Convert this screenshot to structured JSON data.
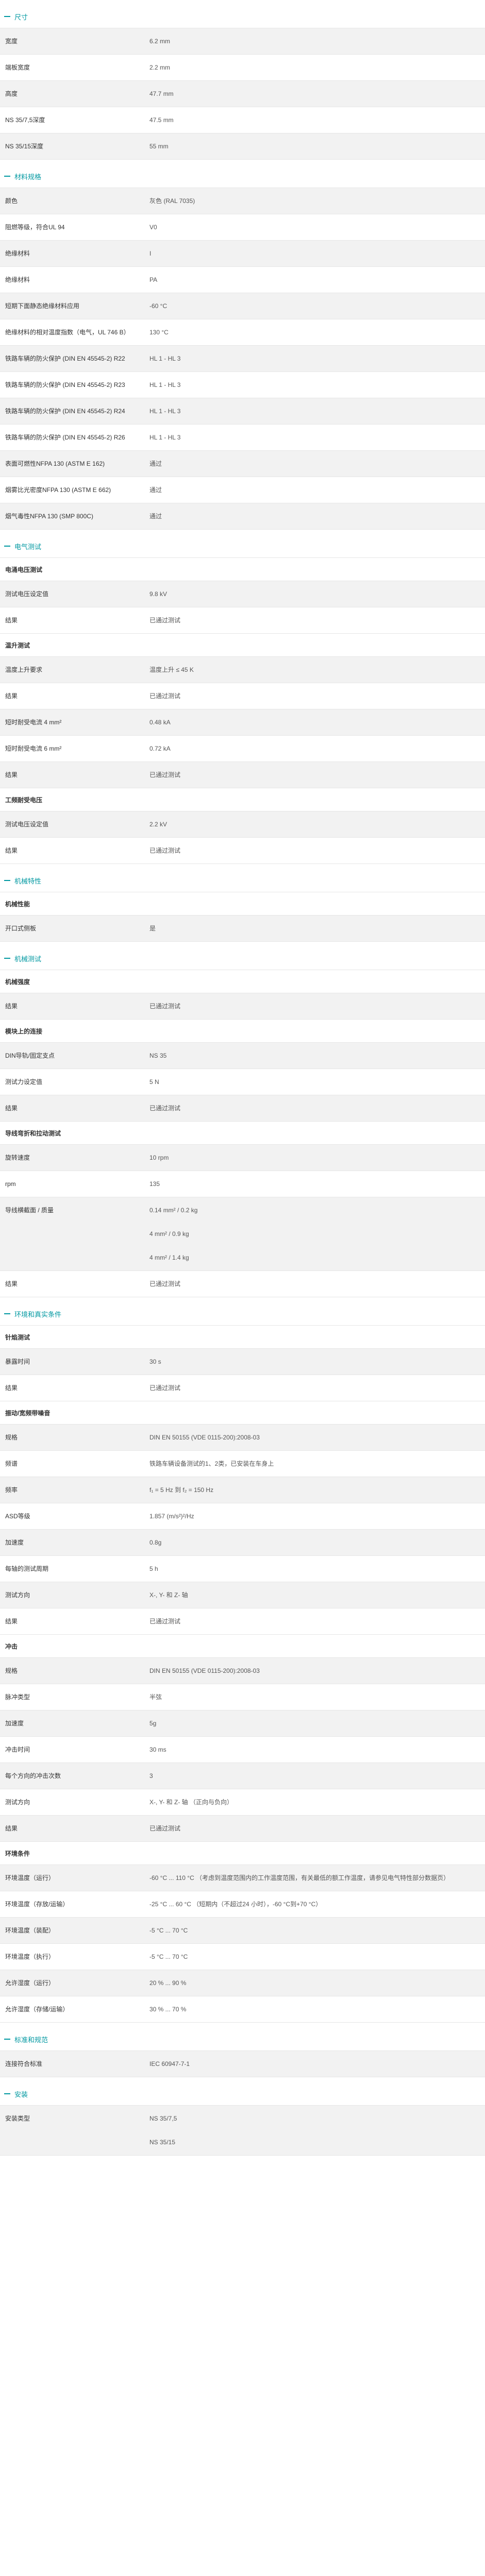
{
  "sections": [
    {
      "title": "尺寸",
      "rows": [
        {
          "label": "宽度",
          "value": [
            "6.2 mm"
          ]
        },
        {
          "label": "端板宽度",
          "value": [
            "2.2 mm"
          ]
        },
        {
          "label": "高度",
          "value": [
            "47.7 mm"
          ]
        },
        {
          "label": "NS 35/7,5深度",
          "value": [
            "47.5 mm"
          ]
        },
        {
          "label": "NS 35/15深度",
          "value": [
            "55 mm"
          ]
        }
      ]
    },
    {
      "title": "材料规格",
      "rows": [
        {
          "label": "颜色",
          "value": [
            "灰色 (RAL 7035)"
          ]
        },
        {
          "label": "阻燃等级，符合UL 94",
          "value": [
            "V0"
          ]
        },
        {
          "label": "绝缘材料",
          "value": [
            "I"
          ]
        },
        {
          "label": "绝缘材料",
          "value": [
            "PA"
          ]
        },
        {
          "label": "短期下面静态绝缘材料应用",
          "value": [
            "-60 °C"
          ]
        },
        {
          "label": "绝缘材料的相对温度指数（电气，UL 746 B）",
          "value": [
            "130 °C"
          ]
        },
        {
          "label": "铁路车辆的防火保护 (DIN EN 45545-2) R22",
          "value": [
            "HL 1 - HL 3"
          ]
        },
        {
          "label": "铁路车辆的防火保护 (DIN EN 45545-2) R23",
          "value": [
            "HL 1 - HL 3"
          ]
        },
        {
          "label": "铁路车辆的防火保护 (DIN EN 45545-2) R24",
          "value": [
            "HL 1 - HL 3"
          ]
        },
        {
          "label": "铁路车辆的防火保护 (DIN EN 45545-2) R26",
          "value": [
            "HL 1 - HL 3"
          ]
        },
        {
          "label": "表面可燃性NFPA 130 (ASTM E 162)",
          "value": [
            "通过"
          ]
        },
        {
          "label": "烟雾比光密度NFPA 130 (ASTM E 662)",
          "value": [
            "通过"
          ]
        },
        {
          "label": "烟气毒性NFPA 130 (SMP 800C)",
          "value": [
            "通过"
          ]
        }
      ]
    },
    {
      "title": "电气测试",
      "groups": [
        {
          "subtitle": "电涌电压测试",
          "rows": [
            {
              "label": "测试电压设定值",
              "value": [
                "9.8 kV"
              ]
            },
            {
              "label": "结果",
              "value": [
                "已通过测试"
              ]
            }
          ]
        },
        {
          "subtitle": "温升测试",
          "rows": [
            {
              "label": "温度上升要求",
              "value": [
                "温度上升 ≤ 45 K"
              ]
            },
            {
              "label": "结果",
              "value": [
                "已通过测试"
              ]
            },
            {
              "label": "短时耐受电流 4 mm²",
              "value": [
                "0.48 kA"
              ]
            },
            {
              "label": "短时耐受电流 6 mm²",
              "value": [
                "0.72 kA"
              ]
            },
            {
              "label": "结果",
              "value": [
                "已通过测试"
              ]
            }
          ]
        },
        {
          "subtitle": "工频耐受电压",
          "rows": [
            {
              "label": "测试电压设定值",
              "value": [
                "2.2 kV"
              ]
            },
            {
              "label": "结果",
              "value": [
                "已通过测试"
              ]
            }
          ]
        }
      ]
    },
    {
      "title": "机械特性",
      "groups": [
        {
          "subtitle": "机械性能",
          "rows": [
            {
              "label": "开口式侧板",
              "value": [
                "是"
              ]
            }
          ]
        }
      ]
    },
    {
      "title": "机械测试",
      "groups": [
        {
          "subtitle": "机械强度",
          "rows": [
            {
              "label": "结果",
              "value": [
                "已通过测试"
              ]
            }
          ]
        },
        {
          "subtitle": "模块上的连接",
          "rows": [
            {
              "label": "DIN导轨/固定支点",
              "value": [
                "NS 35"
              ]
            },
            {
              "label": "测试力设定值",
              "value": [
                "5 N"
              ]
            },
            {
              "label": "结果",
              "value": [
                "已通过测试"
              ]
            }
          ]
        },
        {
          "subtitle": "导线弯折和拉动测试",
          "rows": [
            {
              "label": "旋转速度",
              "value": [
                "10 rpm"
              ]
            },
            {
              "label": "rpm",
              "value": [
                "135"
              ]
            },
            {
              "label": "导线横截面 / 质量",
              "value": [
                "0.14 mm² / 0.2 kg",
                "4 mm² / 0.9 kg",
                "4 mm² / 1.4 kg"
              ]
            },
            {
              "label": "结果",
              "value": [
                "已通过测试"
              ]
            }
          ]
        }
      ]
    },
    {
      "title": "环境和真实条件",
      "groups": [
        {
          "subtitle": "针焰测试",
          "rows": [
            {
              "label": "暴露时间",
              "value": [
                "30 s"
              ]
            },
            {
              "label": "结果",
              "value": [
                "已通过测试"
              ]
            }
          ]
        },
        {
          "subtitle": "振动/宽频带噪音",
          "rows": [
            {
              "label": "规格",
              "value": [
                "DIN EN 50155 (VDE 0115-200):2008-03"
              ]
            },
            {
              "label": "频谱",
              "value": [
                "铁路车辆设备测试的1、2类，已安装在车身上"
              ]
            },
            {
              "label": "频率",
              "value": [
                "f₁ = 5 Hz 到 f₂ = 150 Hz"
              ]
            },
            {
              "label": "ASD等级",
              "value": [
                "1.857 (m/s²)²/Hz"
              ]
            },
            {
              "label": "加速度",
              "value": [
                "0.8g"
              ]
            },
            {
              "label": "每轴的测试周期",
              "value": [
                "5 h"
              ]
            },
            {
              "label": "测试方向",
              "value": [
                "X-, Y- 和 Z- 轴"
              ]
            },
            {
              "label": "结果",
              "value": [
                "已通过测试"
              ]
            }
          ]
        },
        {
          "subtitle": "冲击",
          "rows": [
            {
              "label": "规格",
              "value": [
                "DIN EN 50155 (VDE 0115-200):2008-03"
              ]
            },
            {
              "label": "脉冲类型",
              "value": [
                "半弦"
              ]
            },
            {
              "label": "加速度",
              "value": [
                "5g"
              ]
            },
            {
              "label": "冲击时间",
              "value": [
                "30 ms"
              ]
            },
            {
              "label": "每个方向的冲击次数",
              "value": [
                "3"
              ]
            },
            {
              "label": "测试方向",
              "value": [
                "X-, Y- 和 Z- 轴 （正向与负向）"
              ]
            },
            {
              "label": "结果",
              "value": [
                "已通过测试"
              ]
            }
          ]
        },
        {
          "subtitle": "环境条件",
          "rows": [
            {
              "label": "环境温度（运行）",
              "value": [
                "-60 °C ... 110 °C （考虑到温度范围内的工作温度范围，有关最低的额工作温度，请参见电气特性部分数据页）"
              ]
            },
            {
              "label": "环境温度（存放/运输）",
              "value": [
                "-25 °C ... 60 °C （短期内（不超过24 小时），-60 °C到+70 °C）"
              ]
            },
            {
              "label": "环境温度（装配）",
              "value": [
                "-5 °C ... 70 °C"
              ]
            },
            {
              "label": "环境温度（执行）",
              "value": [
                "-5 °C ... 70 °C"
              ]
            },
            {
              "label": "允许湿度（运行）",
              "value": [
                "20 % ... 90 %"
              ]
            },
            {
              "label": "允许湿度（存储/运输）",
              "value": [
                "30 % ... 70 %"
              ]
            }
          ]
        }
      ]
    },
    {
      "title": "标准和规范",
      "rows": [
        {
          "label": "连接符合标准",
          "value": [
            "IEC 60947-7-1"
          ]
        }
      ]
    },
    {
      "title": "安装",
      "rows": [
        {
          "label": "安装类型",
          "value": [
            "NS 35/7,5",
            "NS 35/15"
          ]
        }
      ]
    }
  ]
}
